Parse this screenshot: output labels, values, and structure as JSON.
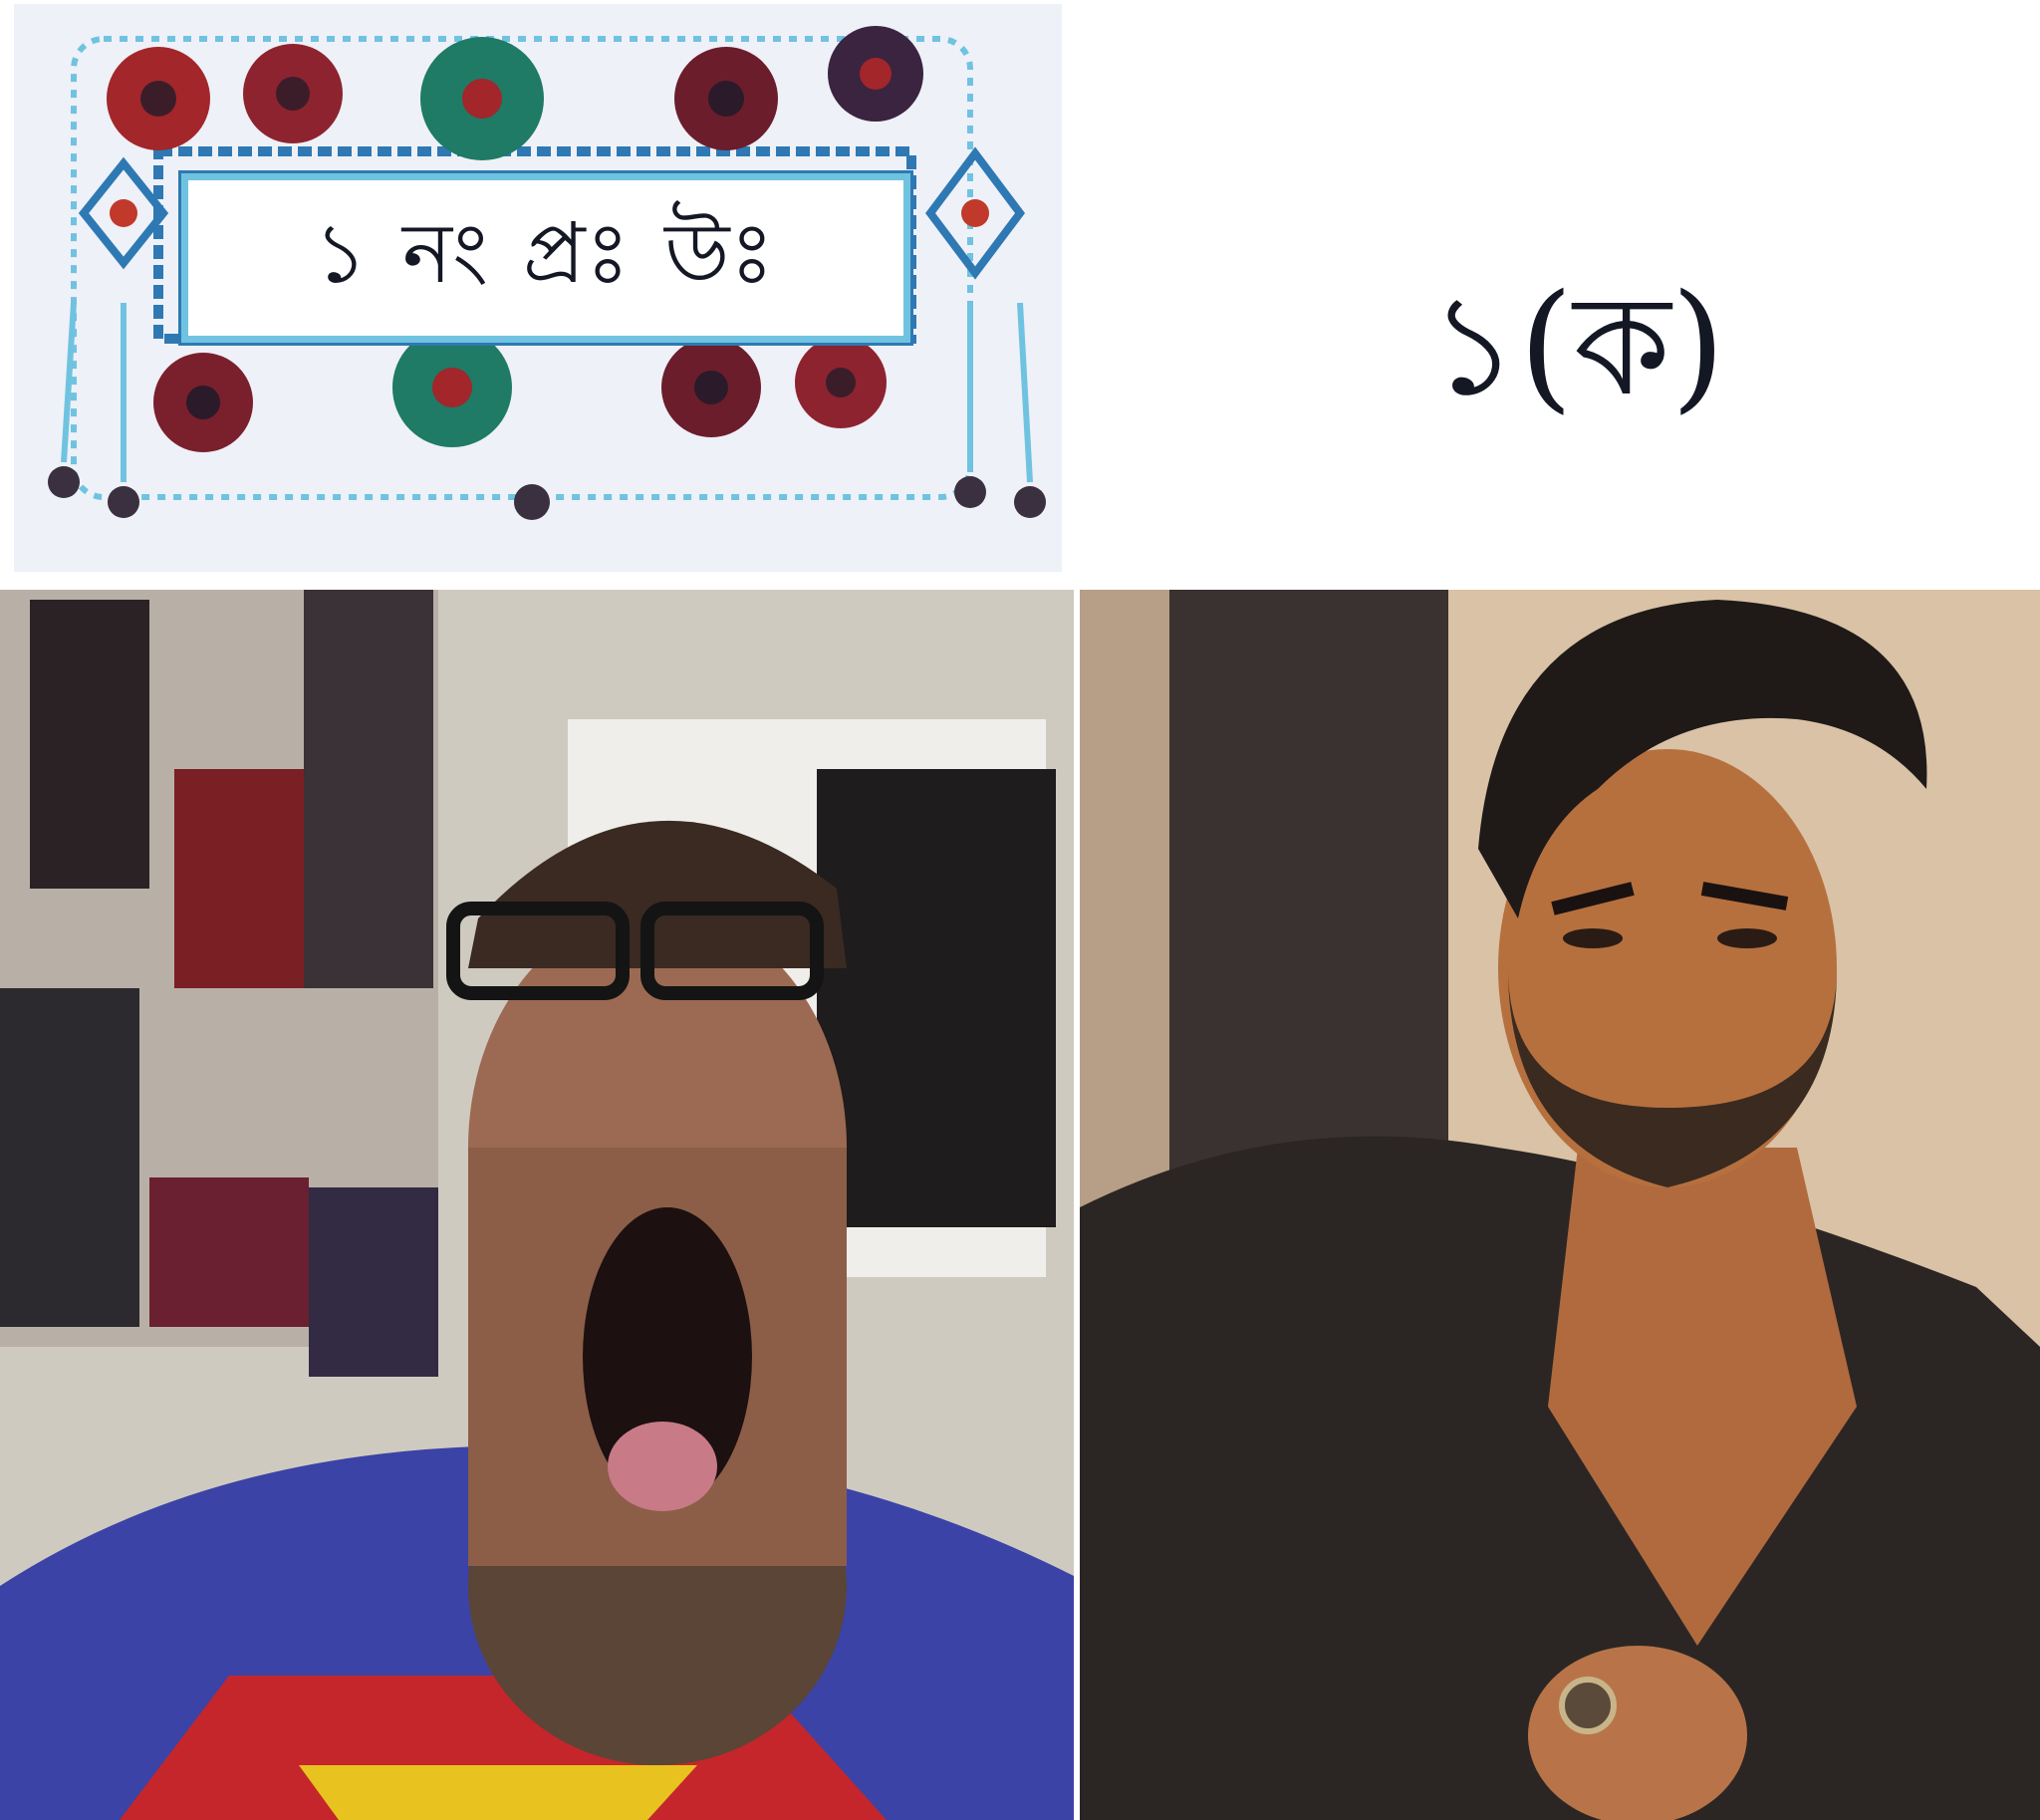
{
  "top_left": {
    "label": "১ নং প্রঃ উঃ"
  },
  "top_right": {
    "label": "১(ক)"
  },
  "colors": {
    "card_bg": "#eef1f7",
    "frame_blue": "#2e79b4",
    "glitter_blue": "#6fc3e0",
    "flower_red": "#a2262a",
    "flower_green": "#1f7a66",
    "ink": "#141824"
  },
  "icons": [
    "decorative-flower",
    "glitter-frame"
  ]
}
